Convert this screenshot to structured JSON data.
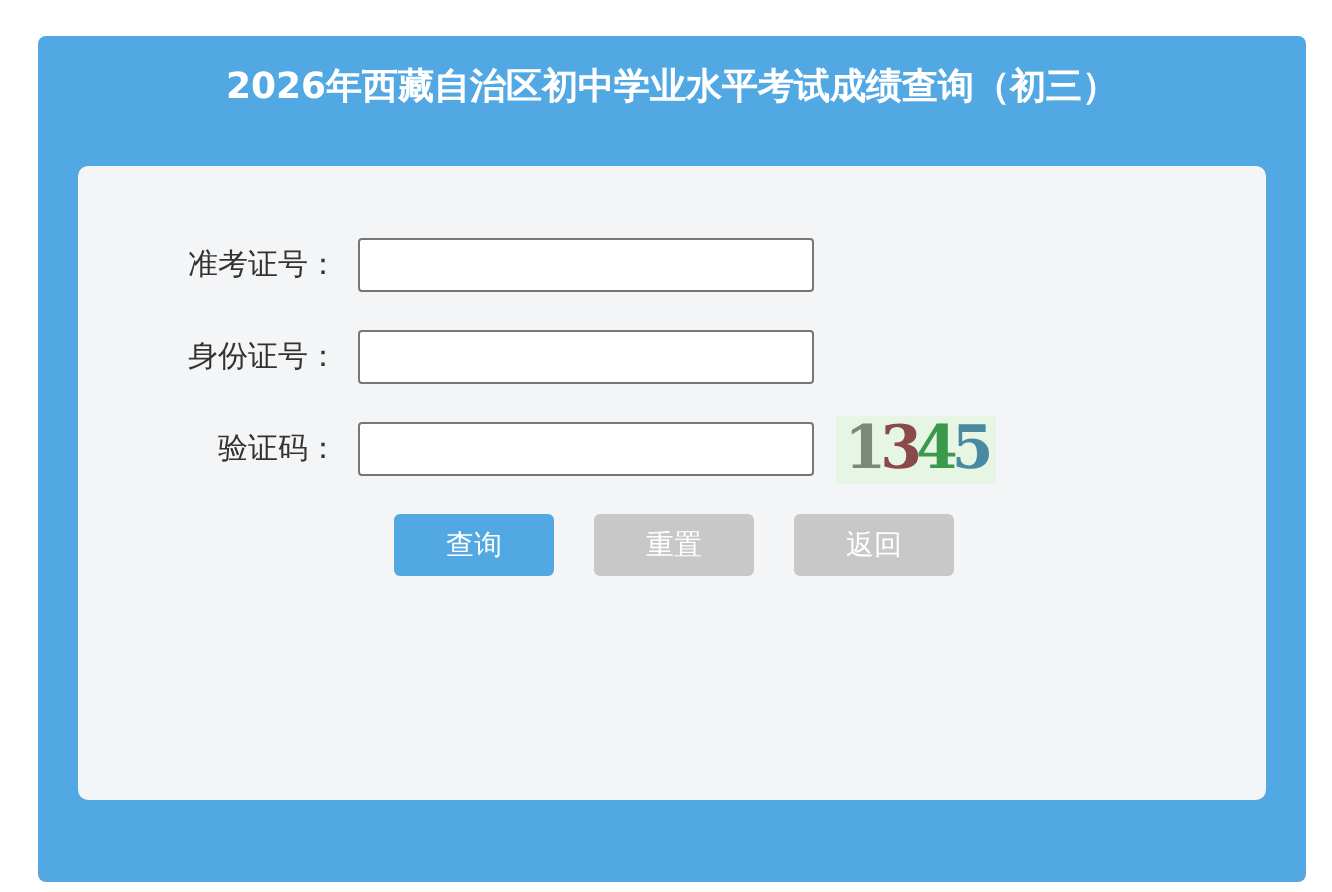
{
  "title": "2026年西藏自治区初中学业水平考试成绩查询（初三）",
  "fields": [
    {
      "label": "准考证号：",
      "kind": "text"
    },
    {
      "label": "身份证号：",
      "kind": "text"
    },
    {
      "label": "验证码：",
      "kind": "captcha",
      "captcha": "1345"
    }
  ],
  "buttons": [
    {
      "label": "查询",
      "kind": "primary"
    },
    {
      "label": "重置",
      "kind": "secondary"
    },
    {
      "label": "返回",
      "kind": "secondary"
    }
  ]
}
